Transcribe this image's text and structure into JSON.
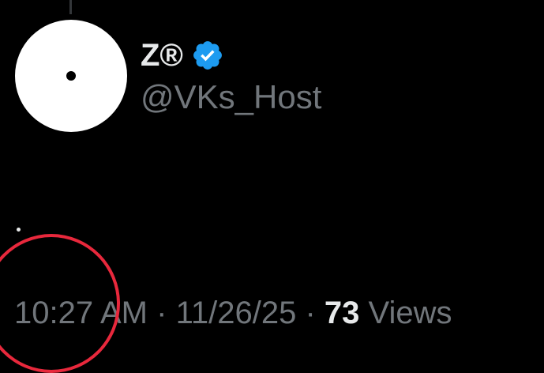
{
  "post": {
    "author": {
      "display_name": "Z®",
      "handle": "@VKs_Host",
      "verified": true,
      "verified_badge_color": "#1d9bf0"
    },
    "meta": {
      "time": "10:27 AM",
      "separator": "·",
      "date": "11/26/25",
      "views_count": "73",
      "views_label": "Views"
    }
  },
  "annotation": {
    "shape": "circle",
    "color": "#e8283c"
  },
  "colors": {
    "background": "#000000",
    "primary_text": "#e7e9ea",
    "secondary_text": "#71767b"
  }
}
